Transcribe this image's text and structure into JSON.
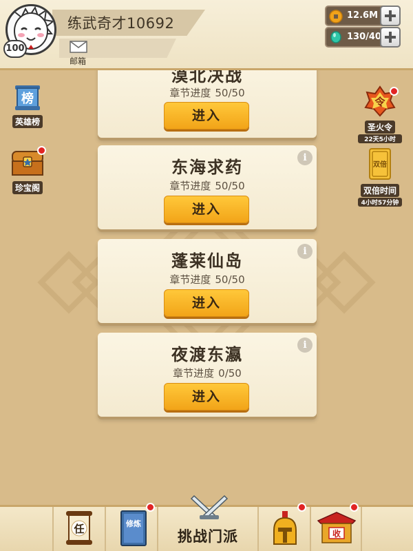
{
  "header": {
    "player_name": "练武奇才10692",
    "level": "100",
    "mail_label": "邮箱",
    "coins": "12.6M",
    "gems": "130/40"
  },
  "side_left": [
    {
      "label": "英雄榜",
      "icon": "ranking-scroll-icon",
      "icon_text": "榜"
    },
    {
      "label": "珍宝阁",
      "icon": "treasure-chest-icon"
    }
  ],
  "side_right": [
    {
      "label": "圣火令",
      "sub": "22天5小时",
      "icon": "fire-token-icon",
      "icon_text": "令"
    },
    {
      "label": "双倍时间",
      "sub": "4小时57分钟",
      "icon": "double-card-icon",
      "icon_text": "双倍"
    }
  ],
  "chapters": [
    {
      "title": "漠北决战",
      "progress_label": "章节进度",
      "progress": "50/50",
      "button": "进入"
    },
    {
      "title": "东海求药",
      "progress_label": "章节进度",
      "progress": "50/50",
      "button": "进入"
    },
    {
      "title": "蓬莱仙岛",
      "progress_label": "章节进度",
      "progress": "50/50",
      "button": "进入"
    },
    {
      "title": "夜渡东瀛",
      "progress_label": "章节进度",
      "progress": "0/50",
      "button": "进入"
    }
  ],
  "bottom_nav": {
    "task_icon_text": "任",
    "train_icon_text": "修炼",
    "center_label": "挑战门派",
    "collect_icon_text": "收"
  },
  "colors": {
    "background": "#d8bb8a",
    "button": "#f2a418",
    "badge_red": "#e12424"
  }
}
